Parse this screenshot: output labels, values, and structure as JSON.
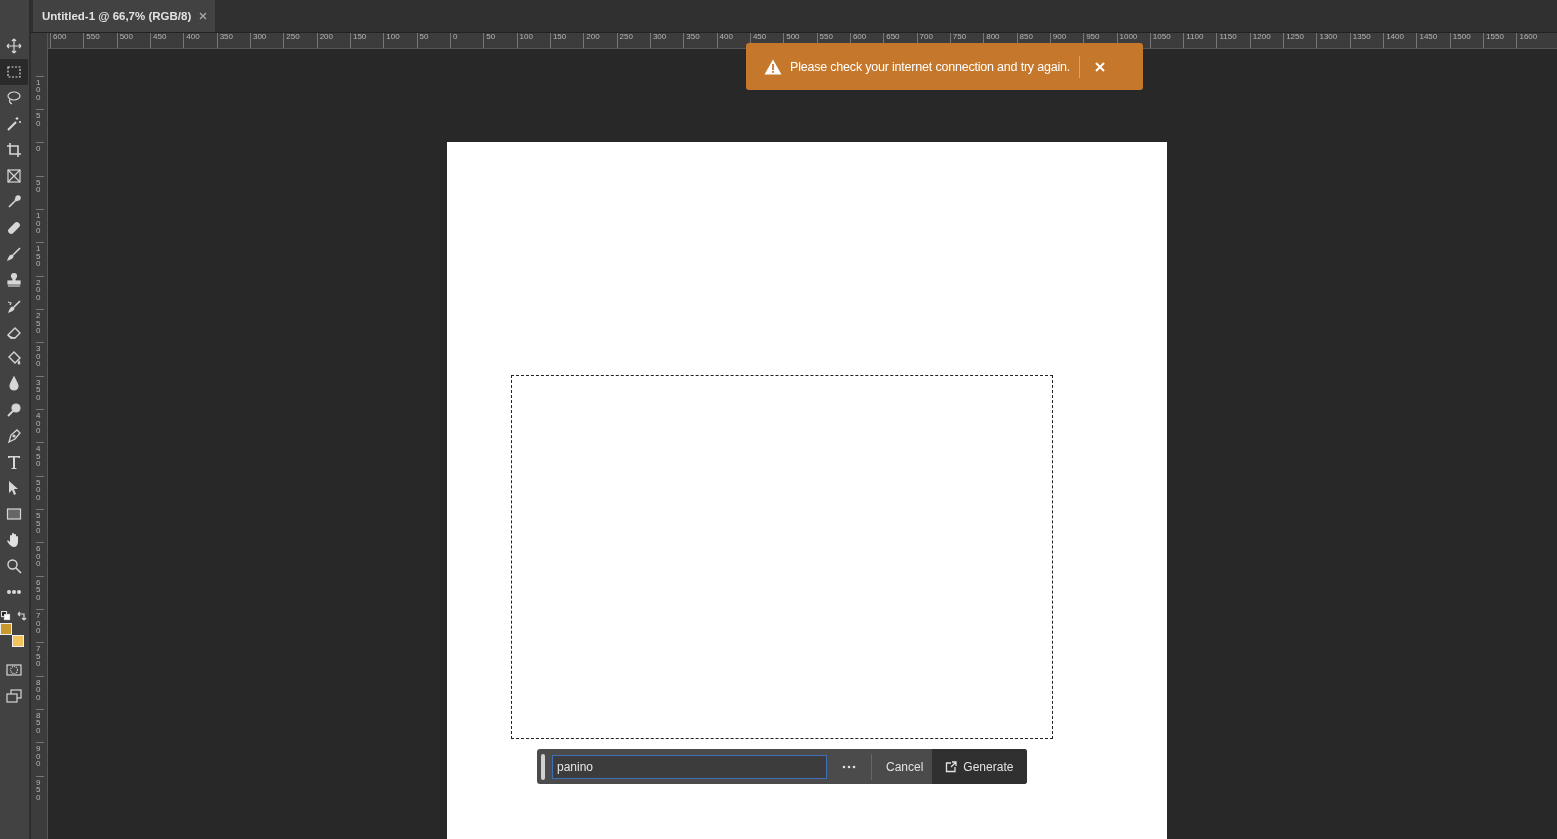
{
  "document_tab": {
    "title": "Untitled-1 @ 66,7% (RGB/8)",
    "selected": true
  },
  "toolbar": {
    "tools": [
      {
        "kind": "move",
        "selected": false
      },
      {
        "kind": "marquee",
        "selected": true
      },
      {
        "kind": "lasso",
        "selected": false
      },
      {
        "kind": "wand",
        "selected": false
      },
      {
        "kind": "crop",
        "selected": false
      },
      {
        "kind": "frame",
        "selected": false
      },
      {
        "kind": "eyedropper",
        "selected": false
      },
      {
        "kind": "bandage",
        "selected": false
      },
      {
        "kind": "brush",
        "selected": false
      },
      {
        "kind": "stamp",
        "selected": false
      },
      {
        "kind": "history",
        "selected": false
      },
      {
        "kind": "eraser",
        "selected": false
      },
      {
        "kind": "bucket",
        "selected": false
      },
      {
        "kind": "drop",
        "selected": false
      },
      {
        "kind": "dodge",
        "selected": false
      },
      {
        "kind": "pen",
        "selected": false
      },
      {
        "kind": "type",
        "selected": false
      },
      {
        "kind": "arrow",
        "selected": false
      },
      {
        "kind": "rectangle",
        "selected": false
      },
      {
        "kind": "hand",
        "selected": false
      },
      {
        "kind": "zoom",
        "selected": false
      },
      {
        "kind": "more",
        "selected": false
      }
    ],
    "color_swatches": [
      {
        "kind": "foreground",
        "color": "#c9992f"
      },
      {
        "kind": "background",
        "color": "#f2c35a"
      }
    ]
  },
  "horizontal_ruler": [
    "600",
    "550",
    "500",
    "450",
    "400",
    "350",
    "300",
    "250",
    "200",
    "150",
    "100",
    "50",
    "0",
    "50",
    "100",
    "150",
    "200",
    "250",
    "300",
    "350",
    "400",
    "450",
    "500",
    "550",
    "600",
    "650",
    "700",
    "750",
    "800",
    "850",
    "900",
    "950",
    "1000",
    "1050",
    "1100",
    "1150",
    "1200",
    "1250",
    "1300",
    "1350",
    "1400",
    "1450",
    "1500",
    "1550",
    "1600"
  ],
  "vertical_ruler": [
    "100",
    "50",
    "0",
    "50",
    "100",
    "150",
    "200",
    "250",
    "300",
    "350",
    "400",
    "450",
    "500",
    "550",
    "600",
    "650",
    "700",
    "750",
    "800",
    "850",
    "900",
    "950"
  ],
  "toast": {
    "message": "Please check your internet connection and try again."
  },
  "generate_bar": {
    "prompt": "panino",
    "buttons": [
      "Cancel",
      "Generate"
    ]
  }
}
